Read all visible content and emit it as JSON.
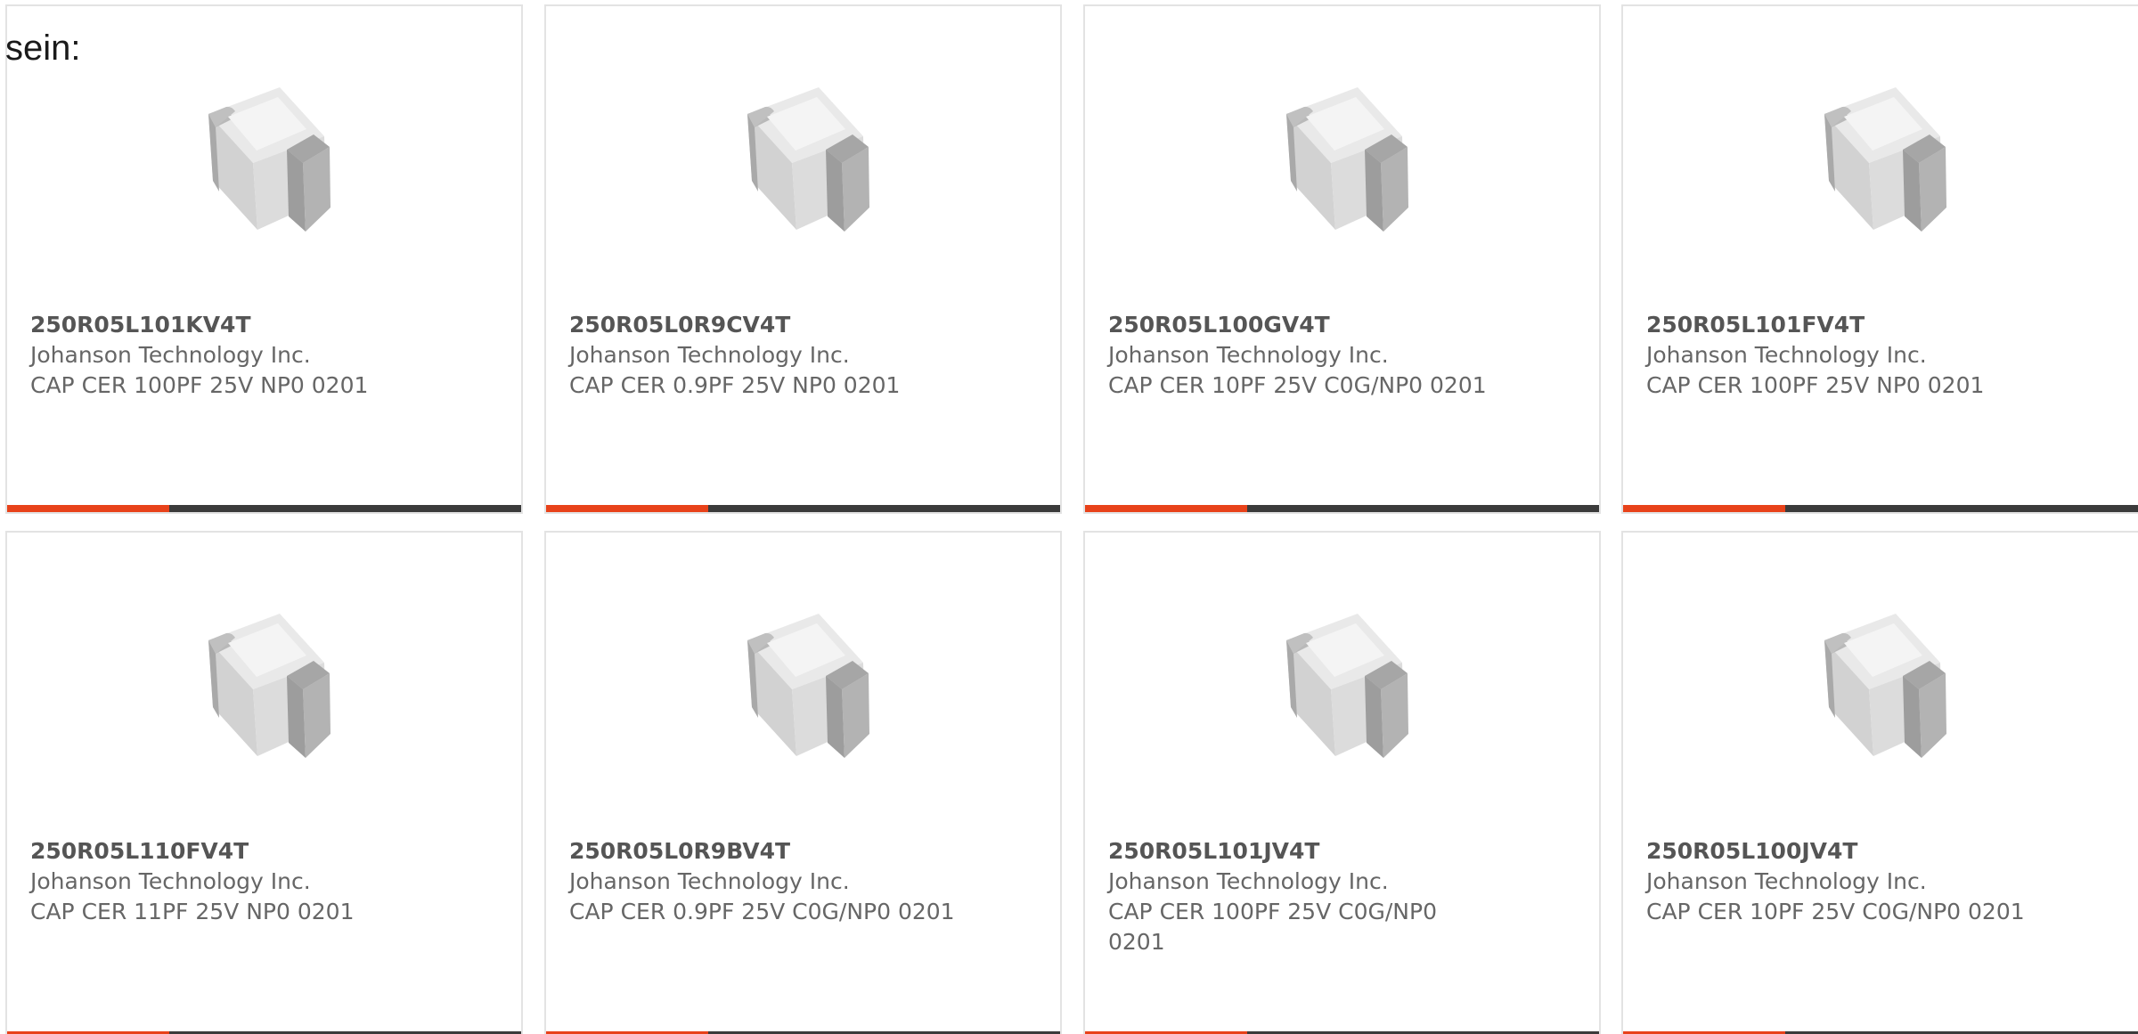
{
  "intro_text": "sein:",
  "colors": {
    "accent": "#e8421a",
    "bar": "#3b3b3b",
    "border": "#e3e3e3",
    "text": "#666666"
  },
  "products": [
    {
      "part": "250R05L101KV4T",
      "maker": "Johanson Technology Inc.",
      "desc": "CAP CER 100PF 25V NP0 0201",
      "image": "chip-capacitor-image"
    },
    {
      "part": "250R05L0R9CV4T",
      "maker": "Johanson Technology Inc.",
      "desc": "CAP CER 0.9PF 25V NP0 0201",
      "image": "chip-capacitor-image"
    },
    {
      "part": "250R05L100GV4T",
      "maker": "Johanson Technology Inc.",
      "desc": "CAP CER 10PF 25V C0G/NP0 0201",
      "image": "chip-capacitor-image"
    },
    {
      "part": "250R05L101FV4T",
      "maker": "Johanson Technology Inc.",
      "desc": "CAP CER 100PF 25V NP0 0201",
      "image": "chip-capacitor-image"
    },
    {
      "part": "250R05L110FV4T",
      "maker": "Johanson Technology Inc.",
      "desc": "CAP CER 11PF 25V NP0 0201",
      "image": "chip-capacitor-image"
    },
    {
      "part": "250R05L0R9BV4T",
      "maker": "Johanson Technology Inc.",
      "desc": "CAP CER 0.9PF 25V C0G/NP0 0201",
      "image": "chip-capacitor-image"
    },
    {
      "part": "250R05L101JV4T",
      "maker": "Johanson Technology Inc.",
      "desc": "CAP CER 100PF 25V C0G/NP0 0201",
      "image": "chip-capacitor-image"
    },
    {
      "part": "250R05L100JV4T",
      "maker": "Johanson Technology Inc.",
      "desc": "CAP CER 10PF 25V C0G/NP0 0201",
      "image": "chip-capacitor-image"
    }
  ]
}
